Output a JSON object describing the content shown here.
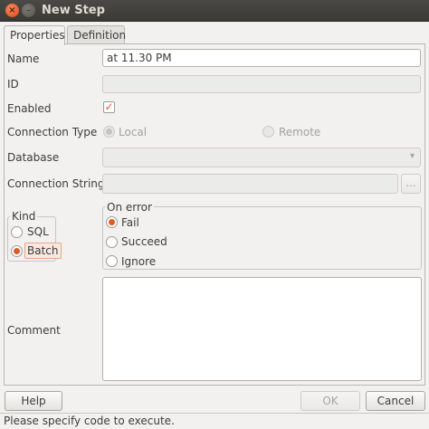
{
  "window": {
    "title": "New Step",
    "close_glyph": "×",
    "min_glyph": "–"
  },
  "tabs": [
    {
      "label": "Properties"
    },
    {
      "label": "Definition"
    }
  ],
  "form": {
    "name_label": "Name",
    "name_value": "at 11.30 PM",
    "id_label": "ID",
    "id_value": "",
    "enabled_label": "Enabled",
    "enabled_checked": true,
    "check_glyph": "✓",
    "connection_type_label": "Connection Type",
    "connection_local_label": "Local",
    "connection_remote_label": "Remote",
    "database_label": "Database",
    "database_value": "",
    "dropdown_glyph": "▾",
    "connection_string_label": "Connection String",
    "connection_string_value": "",
    "browse_label": "...",
    "kind_title": "Kind",
    "kind_sql_label": "SQL",
    "kind_batch_label": "Batch",
    "on_error_title": "On error",
    "on_error_fail_label": "Fail",
    "on_error_succeed_label": "Succeed",
    "on_error_ignore_label": "Ignore",
    "comment_label": "Comment",
    "comment_value": ""
  },
  "buttons": {
    "help": "Help",
    "ok": "OK",
    "cancel": "Cancel"
  },
  "status": {
    "message": "Please specify code to execute."
  },
  "colors": {
    "accent": "#e05a2a",
    "titlebar": "#3c3b37"
  }
}
